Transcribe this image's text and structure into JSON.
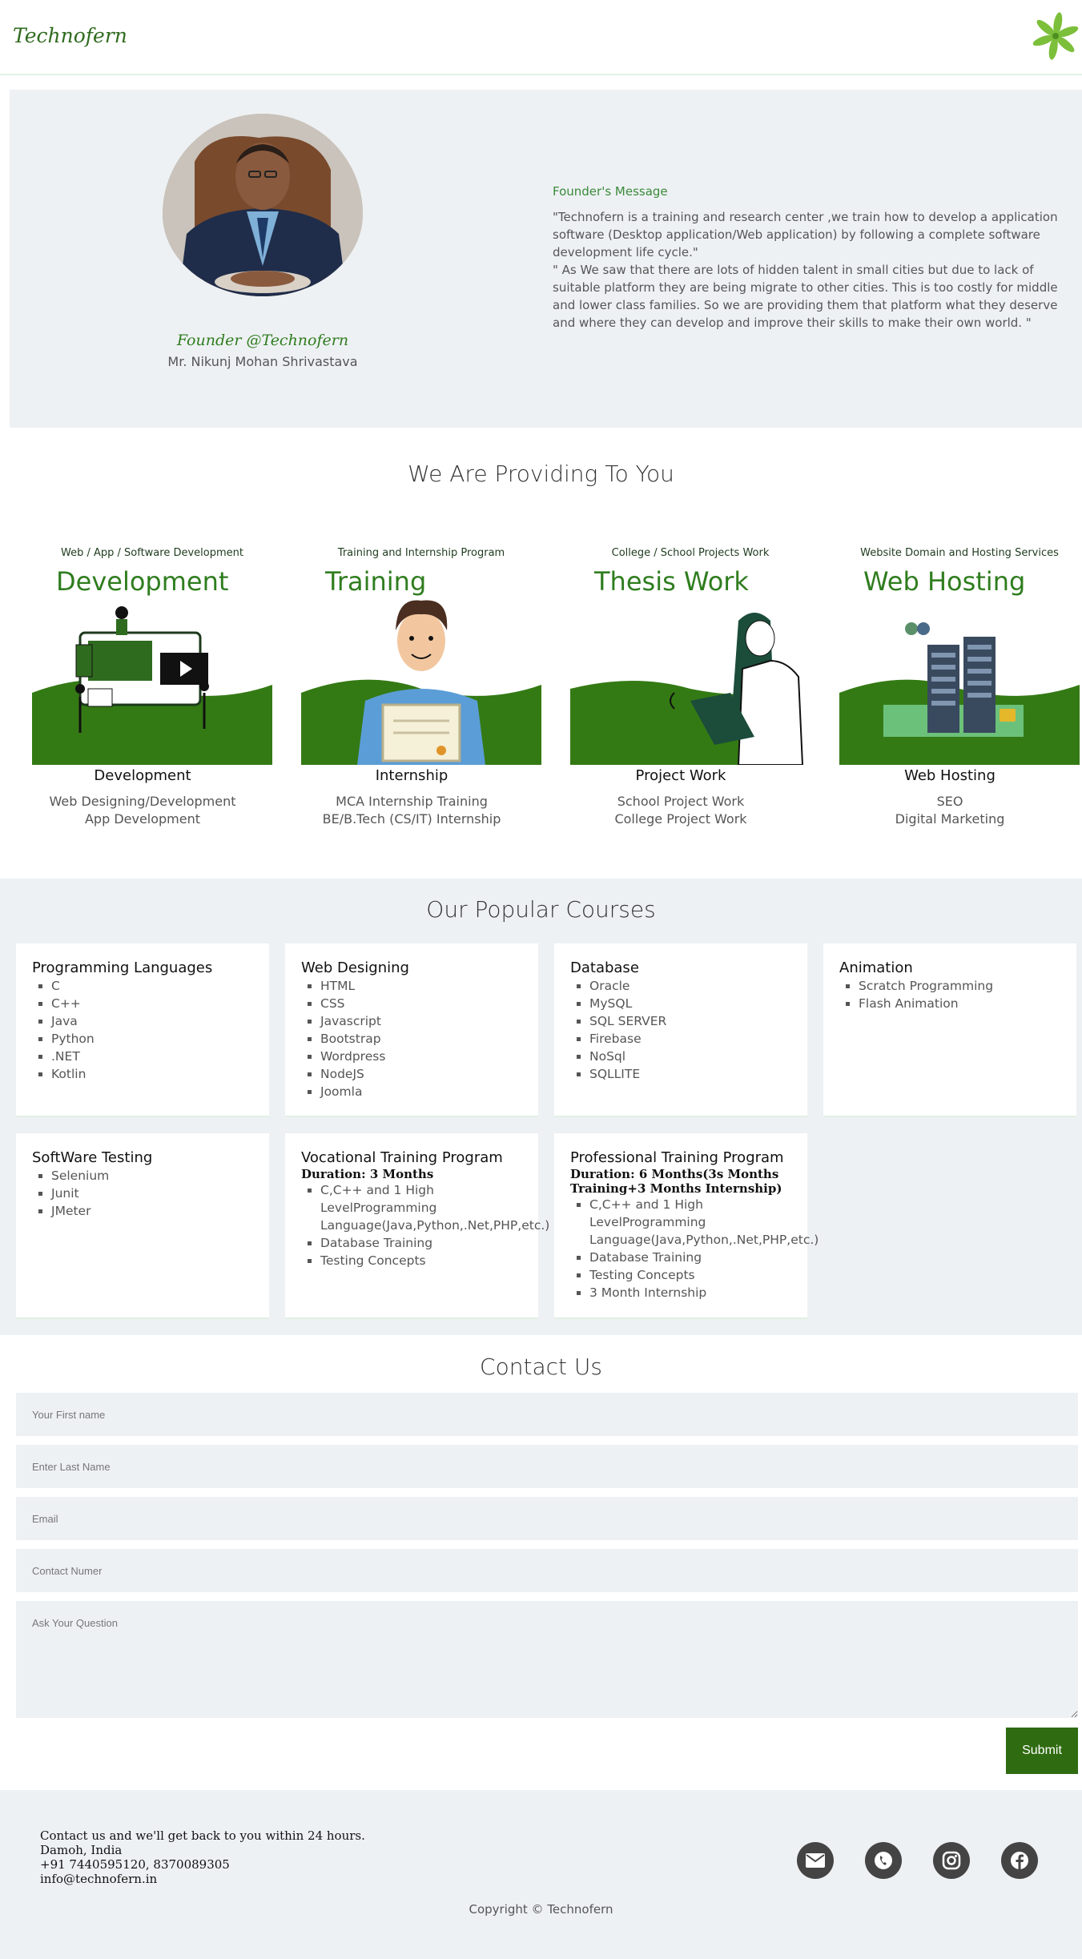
{
  "header": {
    "brand": "Technofern",
    "logo_icon": "leaf-pinwheel-icon"
  },
  "founder": {
    "title": "Founder @Technofern",
    "name": "Mr. Nikunj Mohan Shrivastava",
    "message_heading": "Founder's Message",
    "message_p1": "\"Technofern is a training and research center ,we train how to develop a application software (Desktop application/Web application) by following a complete software development life cycle.\"",
    "message_p2": "\" As We saw that there are lots of hidden talent in small cities but due to lack of suitable platform they are being migrate to other cities. This is too costly for middle and lower class families. So we are providing them that platform what they deserve and where they can develop and improve their skills to make their own world. \""
  },
  "providing": {
    "title": "We Are Providing To You",
    "services": [
      {
        "kicker": "Web / App / Software Development",
        "big": "Development",
        "name": "Development",
        "desc1": "Web Designing/Development",
        "desc2": "App Development"
      },
      {
        "kicker": "Training and Internship Program",
        "big": "Training",
        "name": "Internship",
        "desc1": "MCA Internship Training",
        "desc2": "BE/B.Tech (CS/IT) Internship"
      },
      {
        "kicker": "College / School Projects Work",
        "big": "Thesis Work",
        "name": "Project Work",
        "desc1": "School Project Work",
        "desc2": "College Project Work"
      },
      {
        "kicker": "Website Domain and Hosting Services",
        "big": "Web Hosting",
        "name": "Web Hosting",
        "desc1": "SEO",
        "desc2": "Digital Marketing"
      }
    ]
  },
  "courses": {
    "title": "Our Popular Courses",
    "cards": [
      {
        "title": "Programming Languages",
        "items": [
          "C",
          "C++",
          "Java",
          "Python",
          ".NET",
          "Kotlin"
        ]
      },
      {
        "title": "Web Designing",
        "items": [
          "HTML",
          "CSS",
          "Javascript",
          "Bootstrap",
          "Wordpress",
          "NodeJS",
          "Joomla"
        ]
      },
      {
        "title": "Database",
        "items": [
          "Oracle",
          "MySQL",
          "SQL SERVER",
          "Firebase",
          "NoSql",
          "SQLLITE"
        ]
      },
      {
        "title": "Animation",
        "items": [
          "Scratch Programming",
          "Flash Animation"
        ]
      },
      {
        "title": "SoftWare Testing",
        "items": [
          "Selenium",
          "Junit",
          "JMeter"
        ]
      },
      {
        "title": "Vocational Training Program",
        "duration": "Duration: 3 Months",
        "items": [
          "C,C++ and 1 High LevelProgramming Language(Java,Python,.Net,PHP,etc.)",
          "Database Training",
          "Testing Concepts"
        ]
      },
      {
        "title": "Professional Training Program",
        "duration": "Duration: 6 Months(3s Months Training+3 Months Internship)",
        "items": [
          "C,C++ and 1 High LevelProgramming Language(Java,Python,.Net,PHP,etc.)",
          "Database Training",
          "Testing Concepts",
          "3 Month Internship"
        ]
      }
    ]
  },
  "contact": {
    "title": "Contact Us",
    "first_name_placeholder": "Your First name",
    "last_name_placeholder": "Enter Last Name",
    "email_placeholder": "Email",
    "phone_placeholder": "Contact Numer",
    "question_placeholder": "Ask Your Question",
    "submit_label": "Submit"
  },
  "footer": {
    "line1": "Contact us and we'll get back to you within 24 hours.",
    "line2": "Damoh, India",
    "line3": "+91 7440595120, 8370089305",
    "line4": "info@technofern.in",
    "copyright": "Copyright © Technofern",
    "social_icons": [
      "mail-icon",
      "phone-icon",
      "instagram-icon",
      "facebook-icon"
    ]
  },
  "colors": {
    "brand_green": "#2f7d1f",
    "dark_green": "#2f6b10",
    "panel_gray": "#eef1f4"
  }
}
